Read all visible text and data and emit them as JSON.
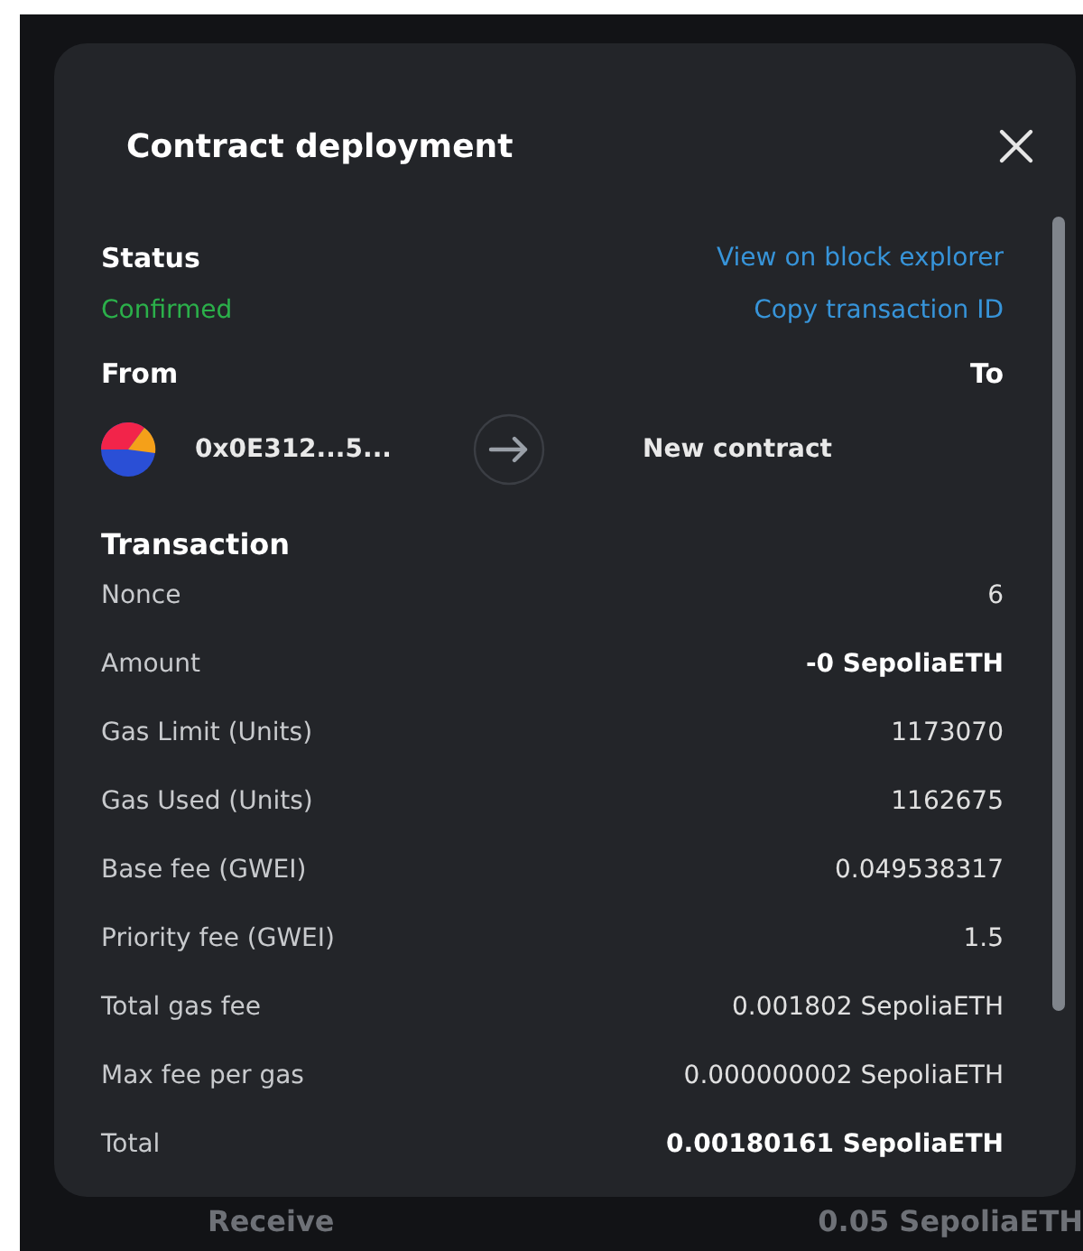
{
  "modal": {
    "title": "Contract deployment",
    "status": {
      "label": "Status",
      "value": "Confirmed",
      "links": [
        "View on block explorer",
        "Copy transaction ID"
      ]
    },
    "from_label": "From",
    "to_label": "To",
    "from_address": "0x0E312...5...",
    "to_value": "New contract",
    "transaction": {
      "heading": "Transaction",
      "rows": [
        {
          "label": "Nonce",
          "value": "6",
          "bold": false
        },
        {
          "label": "Amount",
          "value": "-0 SepoliaETH",
          "bold": true
        },
        {
          "label": "Gas Limit (Units)",
          "value": "1173070",
          "bold": false
        },
        {
          "label": "Gas Used (Units)",
          "value": "1162675",
          "bold": false
        },
        {
          "label": "Base fee (GWEI)",
          "value": "0.049538317",
          "bold": false
        },
        {
          "label": "Priority fee (GWEI)",
          "value": "1.5",
          "bold": false
        },
        {
          "label": "Total gas fee",
          "value": "0.001802 SepoliaETH",
          "bold": false
        },
        {
          "label": "Max fee per gas",
          "value": "0.000000002 SepoliaETH",
          "bold": false
        },
        {
          "label": "Total",
          "value": "0.00180161 SepoliaETH",
          "bold": true
        }
      ]
    }
  },
  "background_activity": {
    "label": "Receive",
    "amount": "0.05 SepoliaETH"
  }
}
